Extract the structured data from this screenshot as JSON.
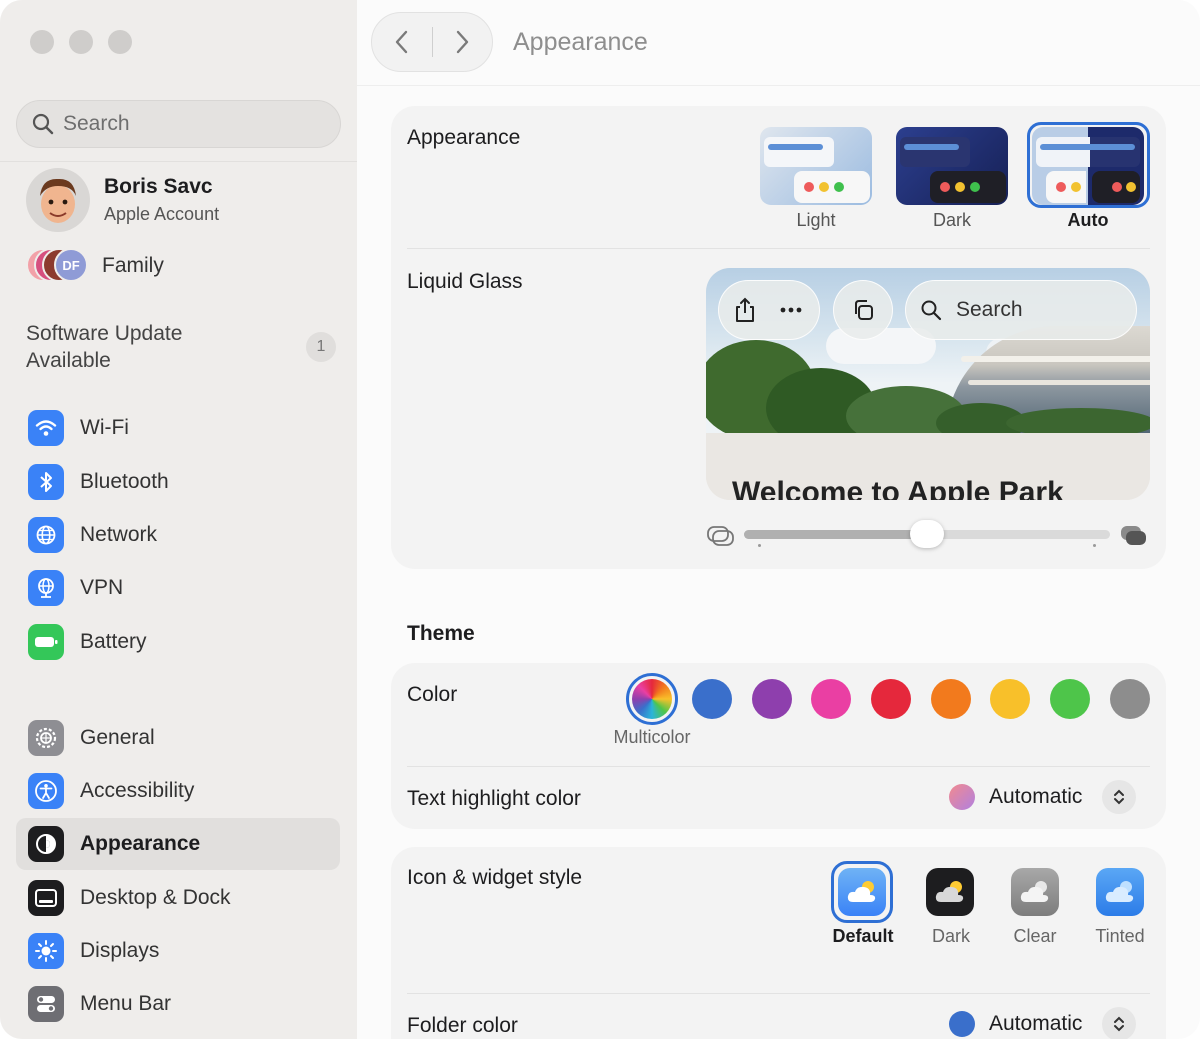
{
  "window": {
    "title": "Appearance"
  },
  "sidebar": {
    "search_placeholder": "Search",
    "account": {
      "name": "Boris Savc",
      "subtitle": "Apple Account"
    },
    "family": {
      "label": "Family",
      "avatar_initials": "DF"
    },
    "update": {
      "label": "Software Update Available",
      "badge": "1"
    },
    "items": [
      {
        "label": "Wi-Fi",
        "icon": "wifi-icon",
        "color": "#3a82f7"
      },
      {
        "label": "Bluetooth",
        "icon": "bluetooth-icon",
        "color": "#3a82f7"
      },
      {
        "label": "Network",
        "icon": "globe-icon",
        "color": "#3a82f7"
      },
      {
        "label": "VPN",
        "icon": "vpn-globe-icon",
        "color": "#3a82f7"
      },
      {
        "label": "Battery",
        "icon": "battery-icon",
        "color": "#34c759"
      },
      {
        "label": "General",
        "icon": "gear-icon",
        "color": "#8e8e93"
      },
      {
        "label": "Accessibility",
        "icon": "accessibility-icon",
        "color": "#3a82f7"
      },
      {
        "label": "Appearance",
        "icon": "appearance-icon",
        "color": "#1d1d1f",
        "selected": true
      },
      {
        "label": "Desktop & Dock",
        "icon": "dock-icon",
        "color": "#1d1d1f"
      },
      {
        "label": "Displays",
        "icon": "sun-icon",
        "color": "#3a82f7"
      },
      {
        "label": "Menu Bar",
        "icon": "menubar-icon",
        "color": "#6e6e73"
      }
    ]
  },
  "main": {
    "title": "Appearance",
    "appearance": {
      "label": "Appearance",
      "options": [
        {
          "label": "Light",
          "selected": false
        },
        {
          "label": "Dark",
          "selected": false
        },
        {
          "label": "Auto",
          "selected": true
        }
      ]
    },
    "liquid_glass": {
      "label": "Liquid Glass",
      "preview_search": "Search",
      "preview_heading": "Welcome to Apple Park",
      "slider_value": 0.5
    },
    "theme": {
      "title": "Theme",
      "color_label": "Color",
      "selected_color_name": "Multicolor",
      "colors": [
        "multicolor",
        "#3a6fcb",
        "#8e3fad",
        "#ea3fa3",
        "#e5283c",
        "#f27a1d",
        "#f8c02a",
        "#4ec54a",
        "#8d8d8d"
      ],
      "highlight": {
        "label": "Text highlight color",
        "value": "Automatic"
      }
    },
    "icon_style": {
      "label": "Icon & widget style",
      "options": [
        {
          "label": "Default",
          "selected": true
        },
        {
          "label": "Dark",
          "selected": false
        },
        {
          "label": "Clear",
          "selected": false
        },
        {
          "label": "Tinted",
          "selected": false
        }
      ]
    },
    "folder": {
      "label": "Folder color",
      "value": "Automatic",
      "color": "#3a6fcb"
    }
  }
}
